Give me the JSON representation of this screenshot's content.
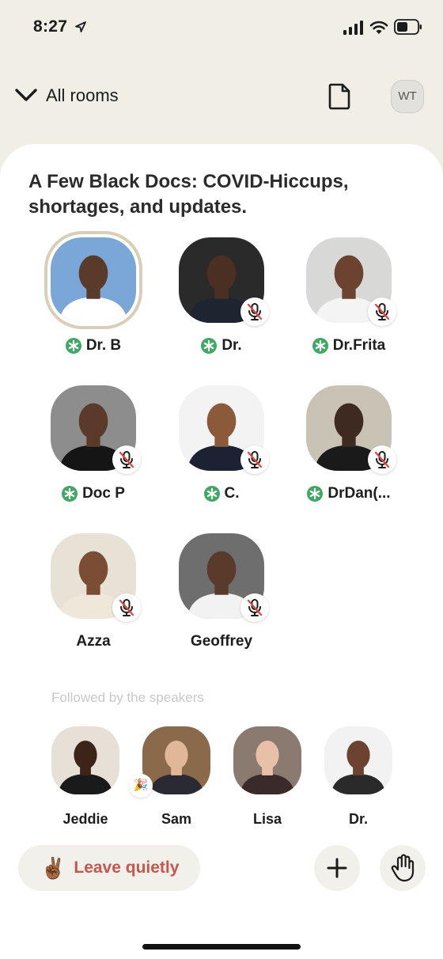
{
  "status_bar": {
    "time": "8:27"
  },
  "topbar": {
    "all_rooms_label": "All rooms",
    "avatar_initials": "WT"
  },
  "room": {
    "title": "A Few Black Docs:  COVID-Hiccups, shortages, and updates."
  },
  "speakers": [
    {
      "name": "Dr. B",
      "moderator": true,
      "muted": false,
      "speaking": true,
      "bg": "#7aa6d8",
      "skin": "#5a3a28",
      "shirt": "#ffffff"
    },
    {
      "name": "Dr.",
      "moderator": true,
      "muted": true,
      "speaking": false,
      "bg": "#2a2a2a",
      "skin": "#4a2f22",
      "shirt": "#1d2530"
    },
    {
      "name": "Dr.Frita",
      "moderator": true,
      "muted": true,
      "speaking": false,
      "bg": "#d8d8d6",
      "skin": "#6b4330",
      "shirt": "#f4f4f4"
    },
    {
      "name": "Doc P",
      "moderator": true,
      "muted": true,
      "speaking": false,
      "bg": "#8d8d8d",
      "skin": "#5b3a2a",
      "shirt": "#151515"
    },
    {
      "name": "C.",
      "moderator": true,
      "muted": true,
      "speaking": false,
      "bg": "#f3f3f3",
      "skin": "#8a5a3a",
      "shirt": "#1a2233"
    },
    {
      "name": "DrDan(...",
      "moderator": true,
      "muted": true,
      "speaking": false,
      "bg": "#c9c3b6",
      "skin": "#3e2a20",
      "shirt": "#1a1a1a"
    },
    {
      "name": "Azza",
      "moderator": false,
      "muted": true,
      "speaking": false,
      "bg": "#e8e2d6",
      "skin": "#7a4d34",
      "shirt": "#efe8da"
    },
    {
      "name": "Geoffrey",
      "moderator": false,
      "muted": true,
      "speaking": false,
      "bg": "#6e6e6e",
      "skin": "#5a3a2a",
      "shirt": "#f2f2f2"
    }
  ],
  "followed_label": "Followed by the speakers",
  "listeners": [
    {
      "name": "Jeddie",
      "bg": "#e6e0d6",
      "skin": "#3c2418",
      "shirt": "#1a1a1a",
      "badge": ""
    },
    {
      "name": "Sam",
      "bg": "#8a6a4a",
      "skin": "#e0b898",
      "shirt": "#2a2a32",
      "badge": "🎉"
    },
    {
      "name": "Lisa",
      "bg": "#8a7a70",
      "skin": "#e8c0a8",
      "shirt": "#3a2a2a",
      "badge": ""
    },
    {
      "name": "Dr.",
      "bg": "#f2f2f2",
      "skin": "#6b4330",
      "shirt": "#2a2a2a",
      "badge": ""
    }
  ],
  "actions": {
    "leave_label": "Leave quietly",
    "leave_emoji": "✌🏾"
  },
  "colors": {
    "background": "#f1efe5",
    "sheet": "#ffffff",
    "leave_text": "#c7564e",
    "moderator_green": "#3fa864"
  }
}
